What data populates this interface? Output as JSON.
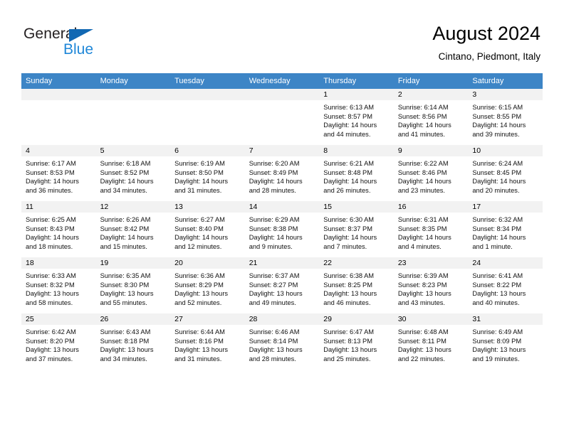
{
  "brand": {
    "name_part1": "General",
    "name_part2": "Blue",
    "accent_color": "#1f87d8",
    "logo_triangle_color": "#1268b3"
  },
  "header": {
    "title": "August 2024",
    "subtitle": "Cintano, Piedmont, Italy"
  },
  "calendar": {
    "header_background": "#3d85c6",
    "weekdays": [
      "Sunday",
      "Monday",
      "Tuesday",
      "Wednesday",
      "Thursday",
      "Friday",
      "Saturday"
    ],
    "weeks": [
      [
        {
          "day": "",
          "lines": []
        },
        {
          "day": "",
          "lines": []
        },
        {
          "day": "",
          "lines": []
        },
        {
          "day": "",
          "lines": []
        },
        {
          "day": "1",
          "lines": [
            "Sunrise: 6:13 AM",
            "Sunset: 8:57 PM",
            "Daylight: 14 hours",
            "and 44 minutes."
          ]
        },
        {
          "day": "2",
          "lines": [
            "Sunrise: 6:14 AM",
            "Sunset: 8:56 PM",
            "Daylight: 14 hours",
            "and 41 minutes."
          ]
        },
        {
          "day": "3",
          "lines": [
            "Sunrise: 6:15 AM",
            "Sunset: 8:55 PM",
            "Daylight: 14 hours",
            "and 39 minutes."
          ]
        }
      ],
      [
        {
          "day": "4",
          "lines": [
            "Sunrise: 6:17 AM",
            "Sunset: 8:53 PM",
            "Daylight: 14 hours",
            "and 36 minutes."
          ]
        },
        {
          "day": "5",
          "lines": [
            "Sunrise: 6:18 AM",
            "Sunset: 8:52 PM",
            "Daylight: 14 hours",
            "and 34 minutes."
          ]
        },
        {
          "day": "6",
          "lines": [
            "Sunrise: 6:19 AM",
            "Sunset: 8:50 PM",
            "Daylight: 14 hours",
            "and 31 minutes."
          ]
        },
        {
          "day": "7",
          "lines": [
            "Sunrise: 6:20 AM",
            "Sunset: 8:49 PM",
            "Daylight: 14 hours",
            "and 28 minutes."
          ]
        },
        {
          "day": "8",
          "lines": [
            "Sunrise: 6:21 AM",
            "Sunset: 8:48 PM",
            "Daylight: 14 hours",
            "and 26 minutes."
          ]
        },
        {
          "day": "9",
          "lines": [
            "Sunrise: 6:22 AM",
            "Sunset: 8:46 PM",
            "Daylight: 14 hours",
            "and 23 minutes."
          ]
        },
        {
          "day": "10",
          "lines": [
            "Sunrise: 6:24 AM",
            "Sunset: 8:45 PM",
            "Daylight: 14 hours",
            "and 20 minutes."
          ]
        }
      ],
      [
        {
          "day": "11",
          "lines": [
            "Sunrise: 6:25 AM",
            "Sunset: 8:43 PM",
            "Daylight: 14 hours",
            "and 18 minutes."
          ]
        },
        {
          "day": "12",
          "lines": [
            "Sunrise: 6:26 AM",
            "Sunset: 8:42 PM",
            "Daylight: 14 hours",
            "and 15 minutes."
          ]
        },
        {
          "day": "13",
          "lines": [
            "Sunrise: 6:27 AM",
            "Sunset: 8:40 PM",
            "Daylight: 14 hours",
            "and 12 minutes."
          ]
        },
        {
          "day": "14",
          "lines": [
            "Sunrise: 6:29 AM",
            "Sunset: 8:38 PM",
            "Daylight: 14 hours",
            "and 9 minutes."
          ]
        },
        {
          "day": "15",
          "lines": [
            "Sunrise: 6:30 AM",
            "Sunset: 8:37 PM",
            "Daylight: 14 hours",
            "and 7 minutes."
          ]
        },
        {
          "day": "16",
          "lines": [
            "Sunrise: 6:31 AM",
            "Sunset: 8:35 PM",
            "Daylight: 14 hours",
            "and 4 minutes."
          ]
        },
        {
          "day": "17",
          "lines": [
            "Sunrise: 6:32 AM",
            "Sunset: 8:34 PM",
            "Daylight: 14 hours",
            "and 1 minute."
          ]
        }
      ],
      [
        {
          "day": "18",
          "lines": [
            "Sunrise: 6:33 AM",
            "Sunset: 8:32 PM",
            "Daylight: 13 hours",
            "and 58 minutes."
          ]
        },
        {
          "day": "19",
          "lines": [
            "Sunrise: 6:35 AM",
            "Sunset: 8:30 PM",
            "Daylight: 13 hours",
            "and 55 minutes."
          ]
        },
        {
          "day": "20",
          "lines": [
            "Sunrise: 6:36 AM",
            "Sunset: 8:29 PM",
            "Daylight: 13 hours",
            "and 52 minutes."
          ]
        },
        {
          "day": "21",
          "lines": [
            "Sunrise: 6:37 AM",
            "Sunset: 8:27 PM",
            "Daylight: 13 hours",
            "and 49 minutes."
          ]
        },
        {
          "day": "22",
          "lines": [
            "Sunrise: 6:38 AM",
            "Sunset: 8:25 PM",
            "Daylight: 13 hours",
            "and 46 minutes."
          ]
        },
        {
          "day": "23",
          "lines": [
            "Sunrise: 6:39 AM",
            "Sunset: 8:23 PM",
            "Daylight: 13 hours",
            "and 43 minutes."
          ]
        },
        {
          "day": "24",
          "lines": [
            "Sunrise: 6:41 AM",
            "Sunset: 8:22 PM",
            "Daylight: 13 hours",
            "and 40 minutes."
          ]
        }
      ],
      [
        {
          "day": "25",
          "lines": [
            "Sunrise: 6:42 AM",
            "Sunset: 8:20 PM",
            "Daylight: 13 hours",
            "and 37 minutes."
          ]
        },
        {
          "day": "26",
          "lines": [
            "Sunrise: 6:43 AM",
            "Sunset: 8:18 PM",
            "Daylight: 13 hours",
            "and 34 minutes."
          ]
        },
        {
          "day": "27",
          "lines": [
            "Sunrise: 6:44 AM",
            "Sunset: 8:16 PM",
            "Daylight: 13 hours",
            "and 31 minutes."
          ]
        },
        {
          "day": "28",
          "lines": [
            "Sunrise: 6:46 AM",
            "Sunset: 8:14 PM",
            "Daylight: 13 hours",
            "and 28 minutes."
          ]
        },
        {
          "day": "29",
          "lines": [
            "Sunrise: 6:47 AM",
            "Sunset: 8:13 PM",
            "Daylight: 13 hours",
            "and 25 minutes."
          ]
        },
        {
          "day": "30",
          "lines": [
            "Sunrise: 6:48 AM",
            "Sunset: 8:11 PM",
            "Daylight: 13 hours",
            "and 22 minutes."
          ]
        },
        {
          "day": "31",
          "lines": [
            "Sunrise: 6:49 AM",
            "Sunset: 8:09 PM",
            "Daylight: 13 hours",
            "and 19 minutes."
          ]
        }
      ]
    ]
  }
}
